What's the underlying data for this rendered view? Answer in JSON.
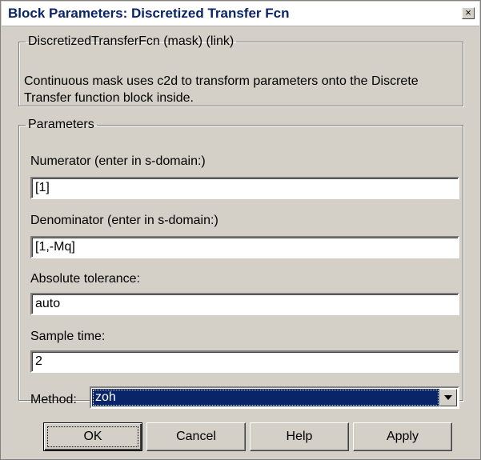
{
  "window": {
    "title": "Block Parameters: Discretized Transfer Fcn",
    "close_glyph": "×"
  },
  "mask": {
    "legend": "DiscretizedTransferFcn (mask) (link)",
    "description": "Continuous mask uses c2d to transform parameters onto the Discrete Transfer function block inside."
  },
  "parameters": {
    "legend": "Parameters",
    "numerator": {
      "label": "Numerator (enter in s-domain:)",
      "value": "[1]"
    },
    "denominator": {
      "label": "Denominator (enter in s-domain:)",
      "value": "[1,-Mq]"
    },
    "abs_tolerance": {
      "label": "Absolute tolerance:",
      "value": "auto"
    },
    "sample_time": {
      "label": "Sample time:",
      "value": "2"
    },
    "method": {
      "label": "Method:",
      "value": "zoh"
    }
  },
  "buttons": {
    "ok": "OK",
    "cancel": "Cancel",
    "help": "Help",
    "apply": "Apply"
  },
  "colors": {
    "title_text": "#0a246a",
    "selection": "#0a246a",
    "dialog_bg": "#d4d0c8"
  }
}
